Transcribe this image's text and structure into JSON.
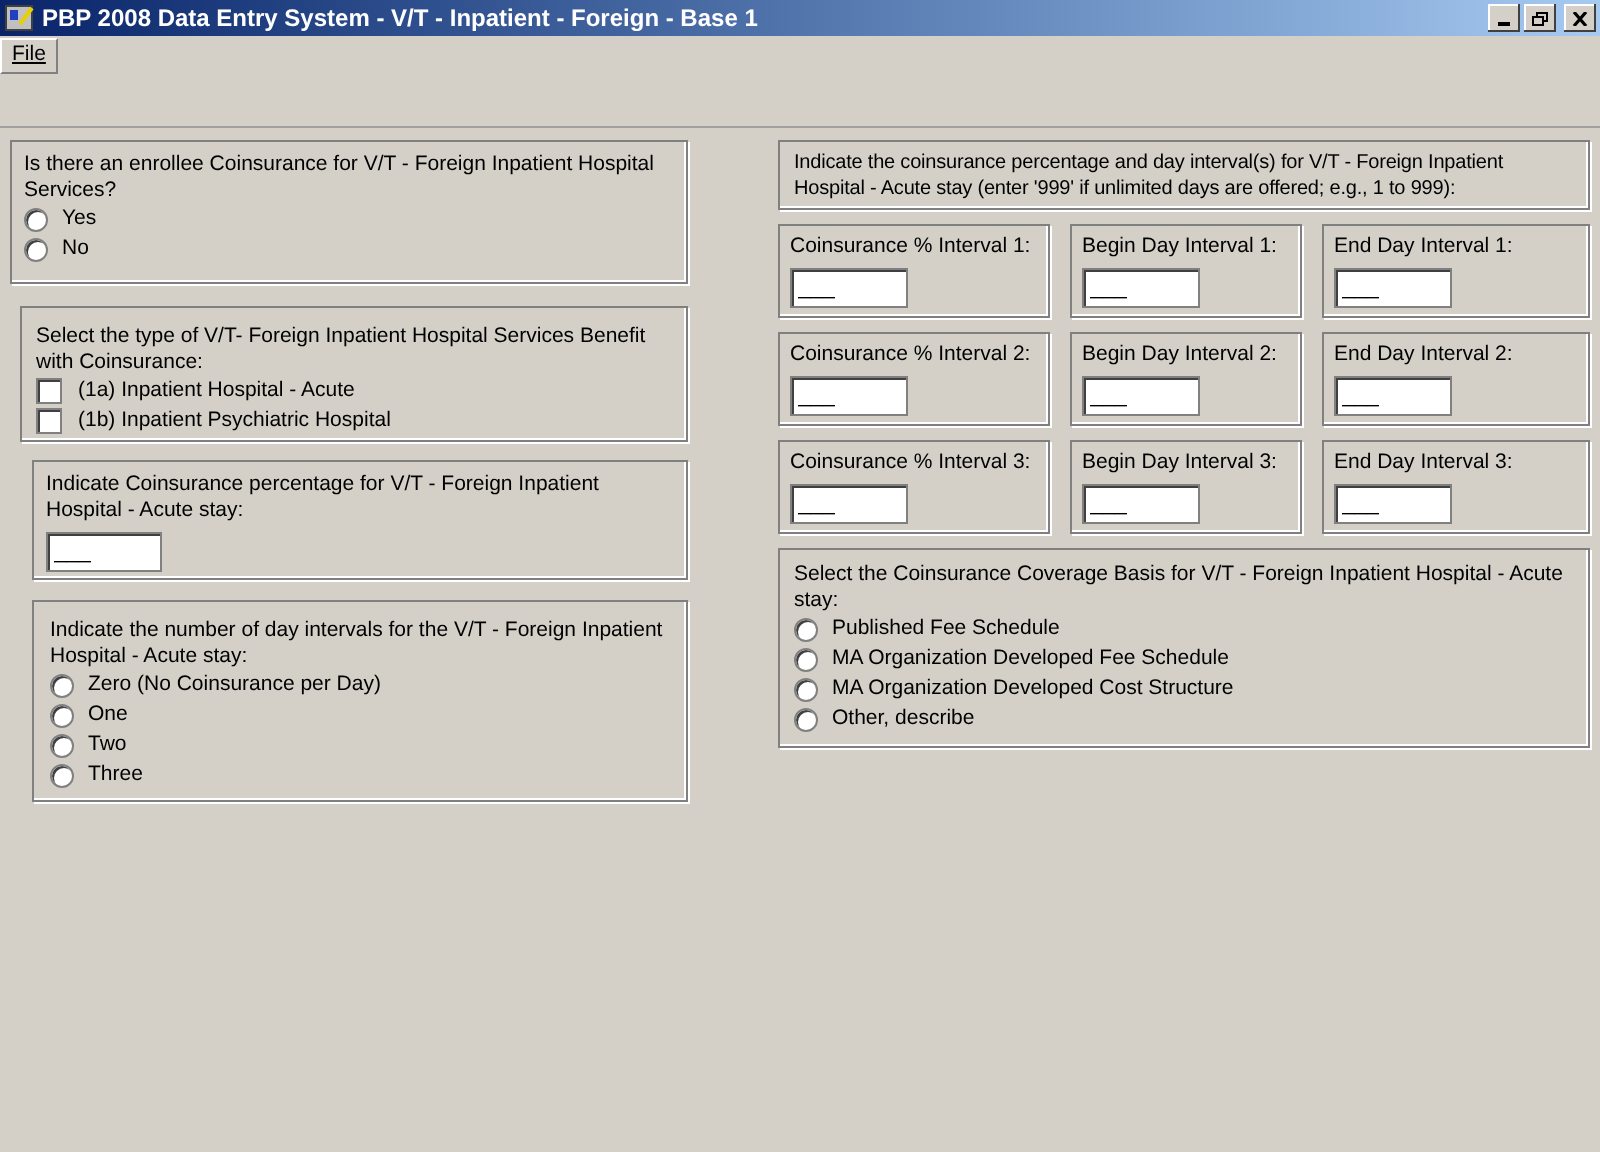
{
  "window": {
    "title": "PBP 2008 Data Entry System - V/T - Inpatient - Foreign - Base 1"
  },
  "menu": [
    "File"
  ],
  "enrollee_coinsurance": {
    "question": "Is there an enrollee Coinsurance for V/T  - Foreign Inpatient Hospital Services?",
    "options": [
      {
        "label": "Yes",
        "selected": false
      },
      {
        "label": "No",
        "selected": false
      }
    ]
  },
  "benefit_type": {
    "question": "Select the type of V/T- Foreign Inpatient Hospital Services Benefit with Coinsurance:",
    "options": [
      {
        "label": "(1a) Inpatient Hospital - Acute",
        "checked": false
      },
      {
        "label": "(1b) Inpatient Psychiatric Hospital",
        "checked": false
      }
    ]
  },
  "coinsurance_percentage": {
    "question": "Indicate Coinsurance percentage for V/T  - Foreign Inpatient Hospital - Acute stay:",
    "value": "___"
  },
  "day_intervals": {
    "question": "Indicate the number of day intervals for the V/T  - Foreign Inpatient Hospital - Acute stay:",
    "options": [
      {
        "label": "Zero (No Coinsurance per Day)",
        "selected": false
      },
      {
        "label": "One",
        "selected": false
      },
      {
        "label": "Two",
        "selected": false
      },
      {
        "label": "Three",
        "selected": false
      }
    ]
  },
  "intervals": {
    "instruction": "Indicate the coinsurance percentage and day interval(s) for V/T  - Foreign Inpatient Hospital - Acute stay (enter '999' if unlimited  days are offered; e.g., 1 to 999):",
    "rows": [
      [
        {
          "label": "Coinsurance % Interval 1:",
          "value": "___"
        },
        {
          "label": "Begin Day Interval 1:",
          "value": "___"
        },
        {
          "label": "End Day Interval 1:",
          "value": "___"
        }
      ],
      [
        {
          "label": "Coinsurance % Interval 2:",
          "value": "___"
        },
        {
          "label": "Begin Day Interval 2:",
          "value": "___"
        },
        {
          "label": "End Day Interval 2:",
          "value": "___"
        }
      ],
      [
        {
          "label": "Coinsurance % Interval 3:",
          "value": "___"
        },
        {
          "label": "Begin Day Interval 3:",
          "value": "___"
        },
        {
          "label": "End Day Interval 3:",
          "value": "___"
        }
      ]
    ]
  },
  "coverage_basis": {
    "question": "Select the Coinsurance Coverage Basis for V/T  - Foreign Inpatient Hospital - Acute stay:",
    "options": [
      {
        "label": "Published Fee Schedule",
        "selected": false
      },
      {
        "label": "MA Organization Developed Fee Schedule",
        "selected": false
      },
      {
        "label": "MA Organization Developed Cost Structure",
        "selected": false
      },
      {
        "label": "Other, describe",
        "selected": false
      }
    ]
  }
}
